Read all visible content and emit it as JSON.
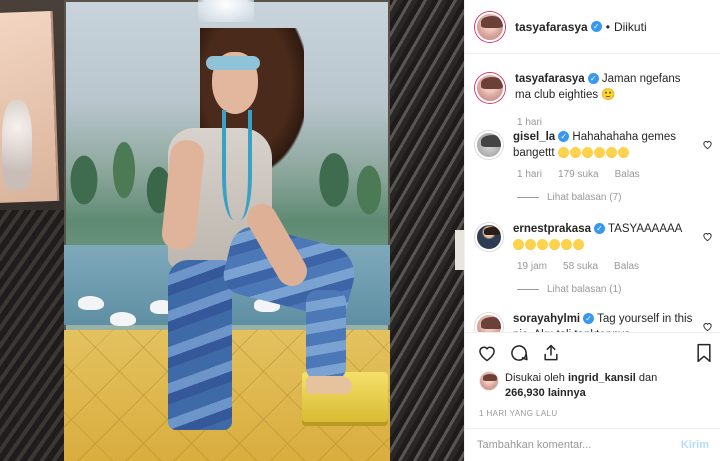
{
  "post": {
    "author": "tasyafarasya",
    "follow_status": "Diikuti",
    "caption": {
      "username": "tasyafarasya",
      "text": "Jaman ngefans ma club eighties",
      "emoji": "🙂",
      "time": "1 hari"
    },
    "comments": [
      {
        "username": "gisel_la",
        "text": "Hahahahaha gemes bangettt",
        "emoji_count": 6,
        "time": "1 hari",
        "likes": "179 suka",
        "reply_label": "Balas",
        "view_replies": "Lihat balasan (7)"
      },
      {
        "username": "ernestprakasa",
        "text": "TASYAAAAAA",
        "emoji_count": 6,
        "time": "19 jam",
        "likes": "58 suka",
        "reply_label": "Balas",
        "view_replies": "Lihat balasan (1)"
      },
      {
        "username": "sorayahylmi",
        "text": "Tag yourself in this pic. Aku tali tanktopnya"
      }
    ],
    "liked_by": {
      "prefix": "Disukai oleh",
      "user": "ingrid_kansil",
      "joiner": "dan",
      "others": "266,930 lainnya"
    },
    "time_ago": "1 HARI YANG LALU",
    "add_comment": {
      "placeholder": "Tambahkan komentar...",
      "send_label": "Kirim"
    }
  },
  "colors": {
    "verified": "#3897f0",
    "send_disabled": "#b3dbff",
    "meta_gray": "#999999"
  },
  "icons": [
    "verified-badge-icon",
    "heart-icon",
    "comment-icon",
    "share-icon",
    "bookmark-icon"
  ]
}
